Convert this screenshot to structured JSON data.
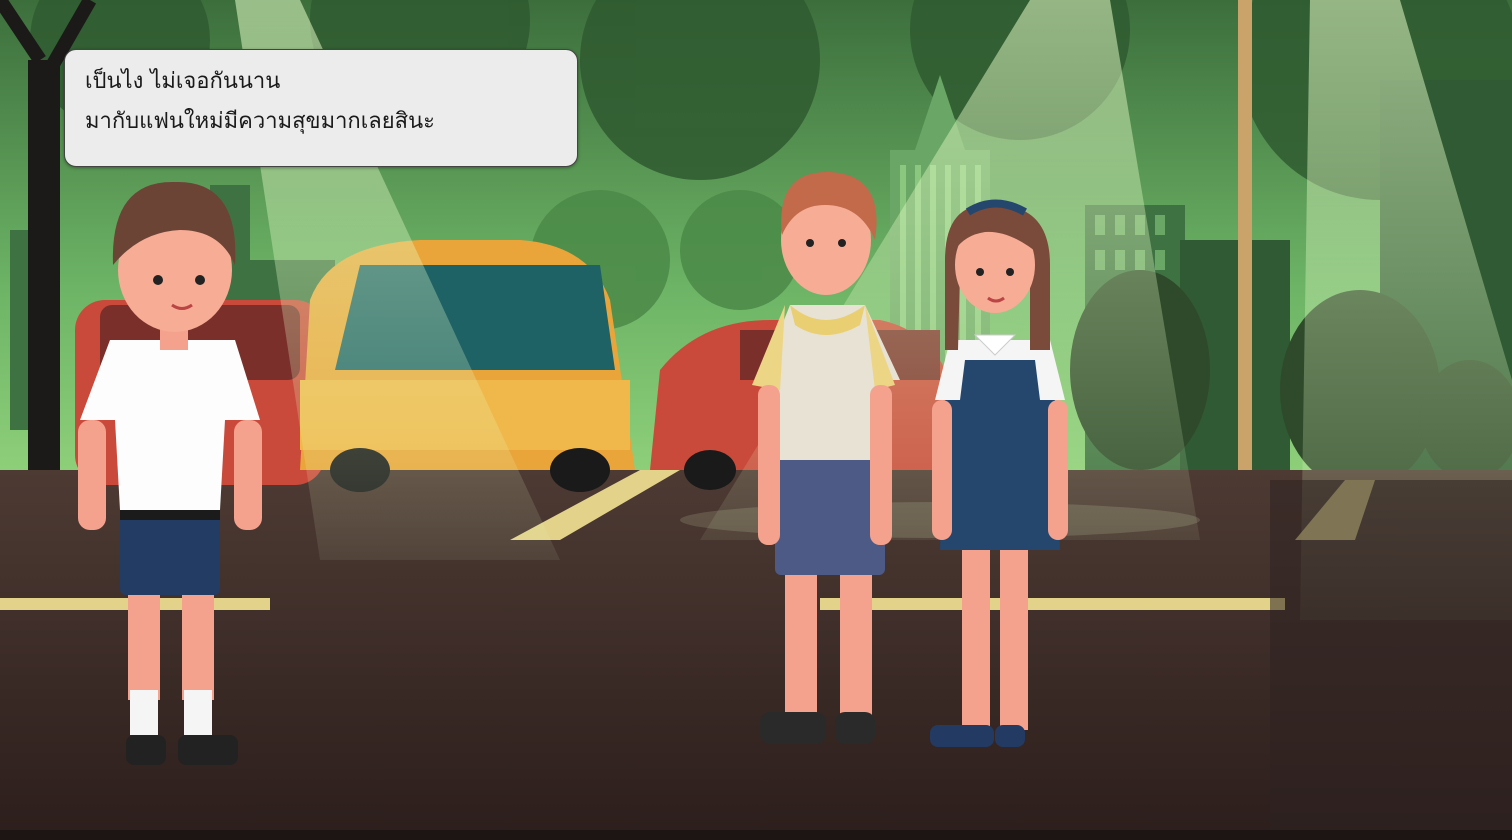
{
  "dialog": {
    "line1": "เป็นไง ไม่เจอกันนาน",
    "line2": "มากับแฟนใหม่มีความสุขมากเลยสินะ"
  },
  "scene": {
    "setting": "parking lot at night with city skyline",
    "characters": [
      {
        "name": "boy-in-white-shirt"
      },
      {
        "name": "boy-in-yellow-hoodie"
      },
      {
        "name": "girl-in-navy-dress"
      }
    ],
    "colors": {
      "sky_green": "#5a9e58",
      "ground": "#3f2b27",
      "dialog_bg": "#ececec"
    }
  }
}
